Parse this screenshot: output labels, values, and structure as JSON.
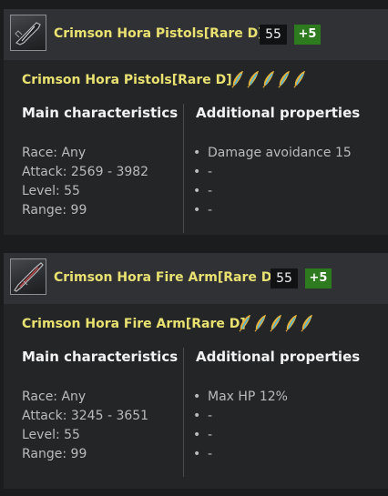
{
  "items": [
    {
      "header_name": "Crimson Hora Pistols[Rare D]",
      "level_badge": "55",
      "enhance_badge": "+5",
      "tooltip_title": "Crimson Hora Pistols[Rare D]",
      "stars": 5,
      "main_heading": "Main characteristics",
      "extra_heading": "Additional properties",
      "stats": [
        "Race: Any",
        "Attack: 2569 - 3982",
        "Level: 55",
        "Range: 99"
      ],
      "properties": [
        "Damage avoidance 15",
        "-",
        "-",
        "-"
      ],
      "icon": "pistols-icon"
    },
    {
      "header_name": "Crimson Hora Fire Arm[Rare D]",
      "level_badge": "55",
      "enhance_badge": "+5",
      "tooltip_title": "Crimson Hora Fire Arm[Rare D]",
      "stars": 5,
      "main_heading": "Main characteristics",
      "extra_heading": "Additional properties",
      "stats": [
        "Race: Any",
        "Attack: 3245 - 3651",
        "Level: 55",
        "Range: 99"
      ],
      "properties": [
        "Max HP 12%",
        "-",
        "-",
        "-"
      ],
      "icon": "fire-arm-icon"
    }
  ],
  "bullet": "•",
  "colors": {
    "title_yellow": "#e9e170",
    "enhance_green": "#2e7a1e",
    "star_gold": "#e8b23a",
    "star_blue": "#4fb4d8"
  }
}
